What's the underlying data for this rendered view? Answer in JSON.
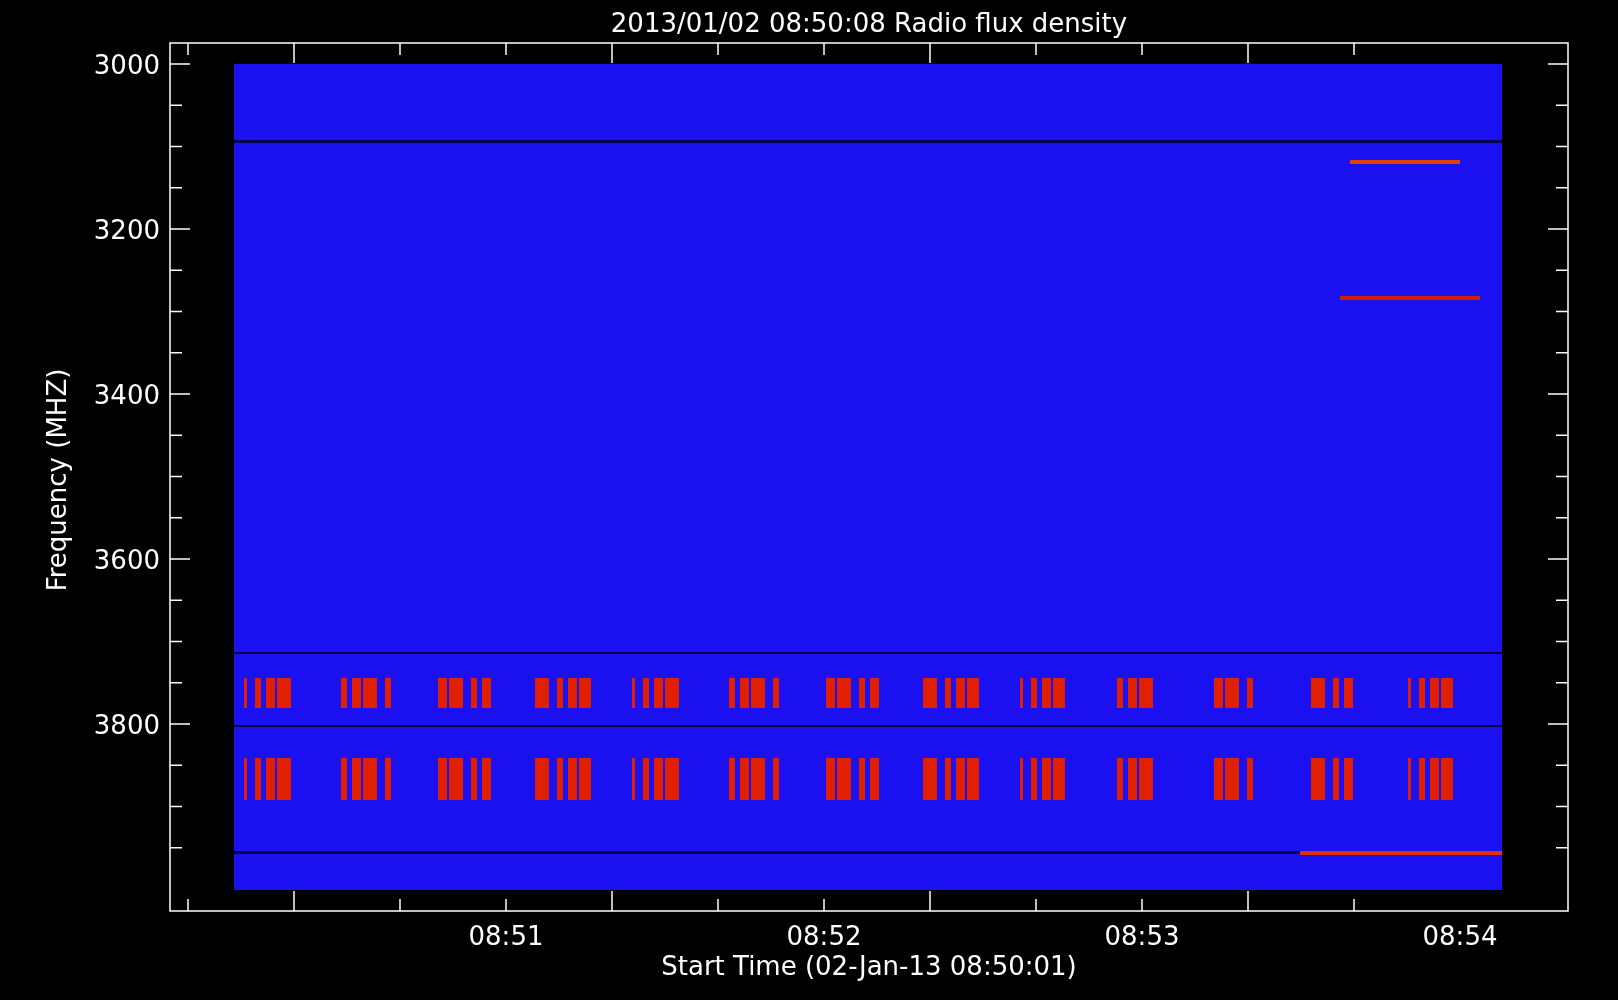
{
  "plot": {
    "title": "2013/01/02 08:50:08 Radio flux density",
    "y_axis": {
      "label": "Frequency (MHZ)",
      "ticks": [
        "3000",
        "3200",
        "3400",
        "3600",
        "3800"
      ]
    },
    "x_axis": {
      "label": "Start Time (02-Jan-13 08:50:01)",
      "ticks": [
        "08:51",
        "08:52",
        "08:53",
        "08:54"
      ]
    }
  }
}
